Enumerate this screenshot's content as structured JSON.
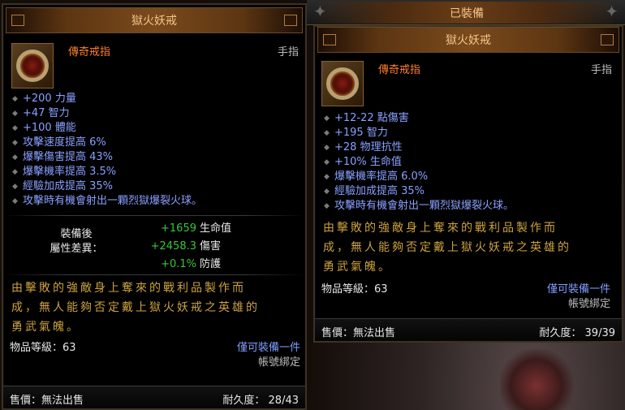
{
  "left": {
    "title": "獄火妖戒",
    "item_type": "傳奇戒指",
    "slot": "手指",
    "affixes": [
      "+200 力量",
      "+47 智力",
      "+100 體能",
      "攻擊速度提高 6%",
      "爆擊傷害提高 43%",
      "爆擊機率提高 3.5%",
      "經驗加成提高 35%",
      "攻擊時有機會射出一顆烈獄爆裂火球。"
    ],
    "diff_label_line1": "裝備後",
    "diff_label_line2": "屬性差異：",
    "diffs": [
      {
        "value": "+1659",
        "stat": "生命值"
      },
      {
        "value": "+2458.3",
        "stat": "傷害"
      },
      {
        "value": "+0.1%",
        "stat": "防護"
      }
    ],
    "flavor_line1": "由擊敗的強敵身上奪來的戰利品製作而",
    "flavor_line2": "成，無人能夠否定戴上獄火妖戒之英雄的",
    "flavor_line3": "勇武氣魄。",
    "item_level": "物品等級：63",
    "unique": "僅可裝備一件",
    "bound": "帳號綁定",
    "sell": "售價：無法出售",
    "durability": "耐久度：  28/43"
  },
  "right": {
    "equipped_label": "已裝備",
    "title": "獄火妖戒",
    "item_type": "傳奇戒指",
    "slot": "手指",
    "affixes": [
      "+12-22 點傷害",
      "+195 智力",
      "+28 物理抗性",
      "+10% 生命值",
      "爆擊機率提高 6.0%",
      "經驗加成提高 35%",
      "攻擊時有機會射出一顆烈獄爆裂火球。"
    ],
    "flavor_line1": "由擊敗的強敵身上奪來的戰利品製作而",
    "flavor_line2": "成，無人能夠否定戴上獄火妖戒之英雄的",
    "flavor_line3": "勇武氣魄。",
    "item_level": "物品等級：63",
    "unique": "僅可裝備一件",
    "bound": "帳號綁定",
    "sell": "售價：無法出售",
    "durability": "耐久度：  39/39"
  },
  "colors": {
    "legendary": "#ff7f2a",
    "magic": "#8aa0ff",
    "flavor": "#cba23f",
    "positive": "#39c639",
    "title": "#f2c589"
  },
  "icons": {
    "item": "ring-icon",
    "bullet": "diamond-bullet-icon"
  }
}
